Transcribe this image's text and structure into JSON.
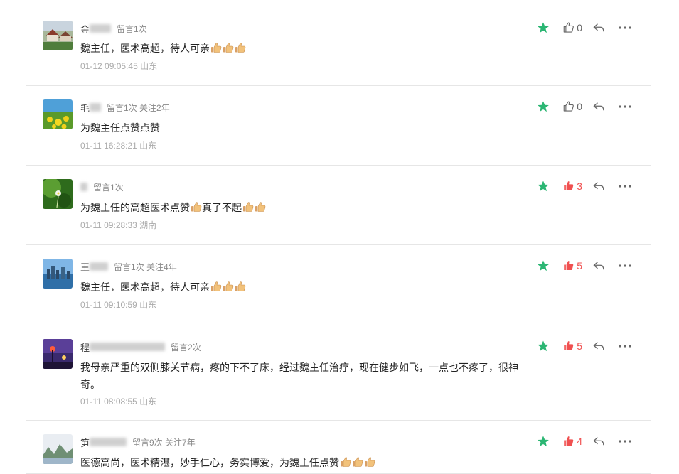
{
  "comments": [
    {
      "nick_visible": "金",
      "meta": "留言1次",
      "content": "魏主任，医术高超，待人可亲",
      "thumbs": 3,
      "time": "01-12 09:05:45 山东",
      "likes": "0",
      "liked": false,
      "avatar": "village-photo"
    },
    {
      "nick_visible": "毛",
      "meta": "留言1次 关注2年",
      "content": "为魏主任点赞点赞",
      "thumbs": 0,
      "time": "01-11 16:28:21 山东",
      "likes": "0",
      "liked": false,
      "avatar": "flowers-photo"
    },
    {
      "nick_visible": "",
      "meta": "留言1次",
      "content": "为魏主任的高超医术点赞",
      "content_after": "真了不起",
      "thumbs": 1,
      "thumbs_after": 2,
      "time": "01-11 09:28:33 湖南",
      "likes": "3",
      "liked": true,
      "avatar": "flower-green-photo"
    },
    {
      "nick_visible": "王",
      "meta": "留言1次 关注4年",
      "content": "魏主任，医术高超，待人可亲",
      "thumbs": 3,
      "time": "01-11 09:10:59 山东",
      "likes": "5",
      "liked": true,
      "avatar": "city-photo"
    },
    {
      "nick_visible": "程",
      "meta": "留言2次",
      "content": "我母亲严重的双侧膝关节病，疼的下不了床，经过魏主任治疗，现在健步如飞，一点也不疼了，很神奇。",
      "thumbs": 0,
      "time": "01-11 08:08:55 山东",
      "likes": "5",
      "liked": true,
      "avatar": "night-photo"
    },
    {
      "nick_visible": "笋",
      "meta": "留言9次 关注7年",
      "content": "医德高尚，医术精湛，妙手仁心，务实博爱，为魏主任点赞",
      "thumbs": 3,
      "time": "",
      "likes": "4",
      "liked": true,
      "avatar": "landscape-photo"
    }
  ],
  "colors": {
    "star": "#2bb673",
    "liked": "#f05050",
    "icon": "#666666"
  },
  "icons": [
    "star-icon",
    "thumbs-up-icon",
    "reply-icon",
    "more-icon",
    "thumbs-up-emoji"
  ]
}
